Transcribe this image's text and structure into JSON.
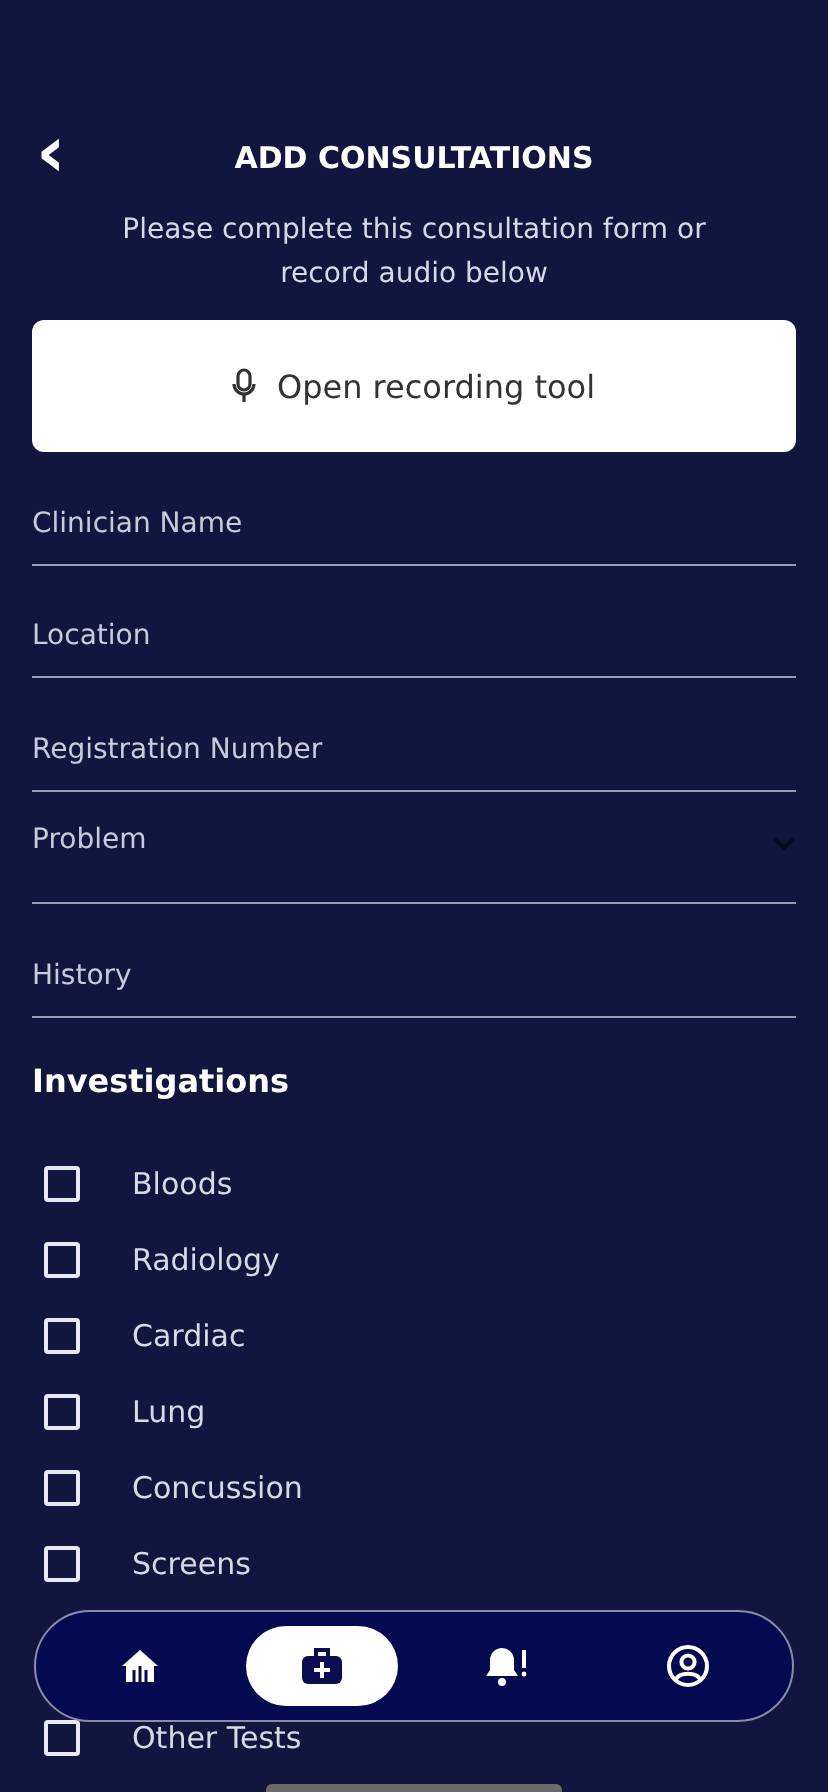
{
  "header": {
    "back": "‹",
    "title": "ADD CONSULTATIONS"
  },
  "intro": "Please complete this consultation form or record audio below",
  "record_button": {
    "label": "Open recording tool"
  },
  "fields": [
    {
      "kind": "text",
      "placeholder": "Clinician Name"
    },
    {
      "kind": "text",
      "placeholder": "Location"
    },
    {
      "kind": "text",
      "placeholder": "Registration Number"
    },
    {
      "kind": "select",
      "placeholder": "Problem"
    },
    {
      "kind": "text",
      "placeholder": "History"
    }
  ],
  "investigations": {
    "title": "Investigations",
    "items": [
      {
        "label": "Bloods",
        "checked": false
      },
      {
        "label": "Radiology",
        "checked": false
      },
      {
        "label": "Cardiac",
        "checked": false
      },
      {
        "label": "Lung",
        "checked": false
      },
      {
        "label": "Concussion",
        "checked": false
      },
      {
        "label": "Screens",
        "checked": false
      },
      {
        "label": "Other Tests",
        "checked": false
      }
    ]
  },
  "nav": [
    {
      "kind": "home",
      "selected": false
    },
    {
      "kind": "medical",
      "selected": true
    },
    {
      "kind": "alerts",
      "selected": false
    },
    {
      "kind": "profile",
      "selected": false
    }
  ]
}
